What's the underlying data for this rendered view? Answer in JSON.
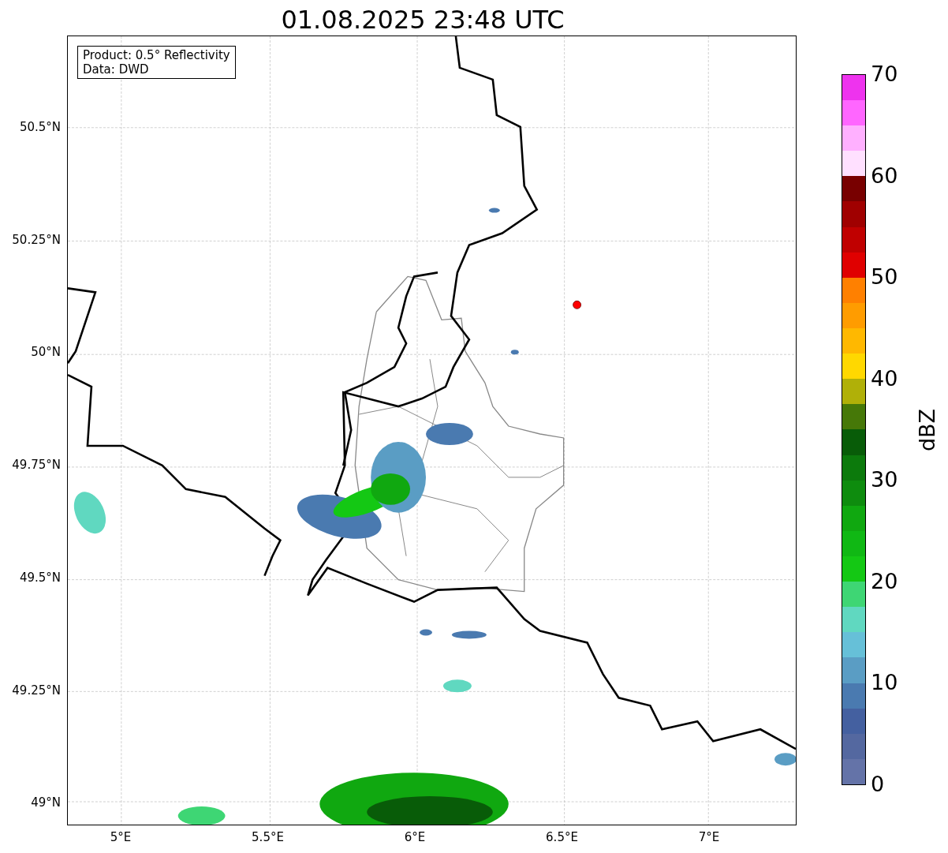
{
  "title": "01.08.2025 23:48 UTC",
  "map": {
    "info_box": [
      "Product: 0.5° Reflectivity",
      "Data: DWD"
    ],
    "lat_ticks": [
      "50.5°N",
      "50.25°N",
      "50°N",
      "49.75°N",
      "49.5°N",
      "49.25°N",
      "49°N"
    ],
    "lon_ticks": [
      "5°E",
      "5.5°E",
      "6°E",
      "6.5°E",
      "7°E"
    ]
  },
  "colorbar": {
    "label": "dBZ",
    "ticks": [
      "70",
      "60",
      "50",
      "40",
      "30",
      "20",
      "10",
      "0"
    ],
    "bins": [
      {
        "color": "#6473a8"
      },
      {
        "color": "#5468a0"
      },
      {
        "color": "#4460a0"
      },
      {
        "color": "#4a7ab0"
      },
      {
        "color": "#5a9dc4"
      },
      {
        "color": "#66c0d8"
      },
      {
        "color": "#60d8c0"
      },
      {
        "color": "#3ed674"
      },
      {
        "color": "#14c814"
      },
      {
        "color": "#10b814"
      },
      {
        "color": "#10a810"
      },
      {
        "color": "#0e8c0e"
      },
      {
        "color": "#0c7a0c"
      },
      {
        "color": "#085c08"
      },
      {
        "color": "#467808"
      },
      {
        "color": "#b0b008"
      },
      {
        "color": "#ffd800"
      },
      {
        "color": "#ffb800"
      },
      {
        "color": "#ff9c00"
      },
      {
        "color": "#ff8000"
      },
      {
        "color": "#e00000"
      },
      {
        "color": "#c00000"
      },
      {
        "color": "#a00000"
      },
      {
        "color": "#780000"
      },
      {
        "color": "#ffe0ff"
      },
      {
        "color": "#ffb0ff"
      },
      {
        "color": "#ff66ff"
      },
      {
        "color": "#ee33ee"
      }
    ]
  }
}
